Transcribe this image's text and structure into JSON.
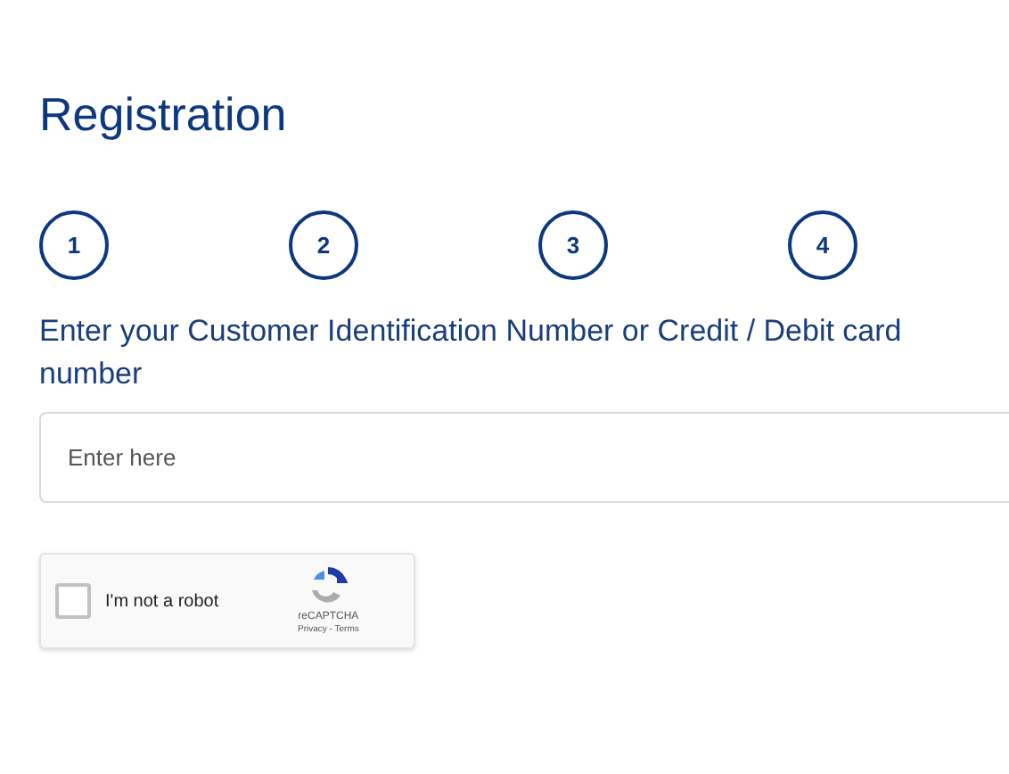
{
  "title": "Registration",
  "steps": [
    {
      "label": "1"
    },
    {
      "label": "2"
    },
    {
      "label": "3"
    },
    {
      "label": "4"
    }
  ],
  "field": {
    "label": "Enter your Customer Identification Number or Credit / Debit card number",
    "placeholder": "Enter here"
  },
  "captcha": {
    "label": "I'm not a robot",
    "checked": false,
    "brand": "reCAPTCHA",
    "links": "Privacy - Terms"
  }
}
